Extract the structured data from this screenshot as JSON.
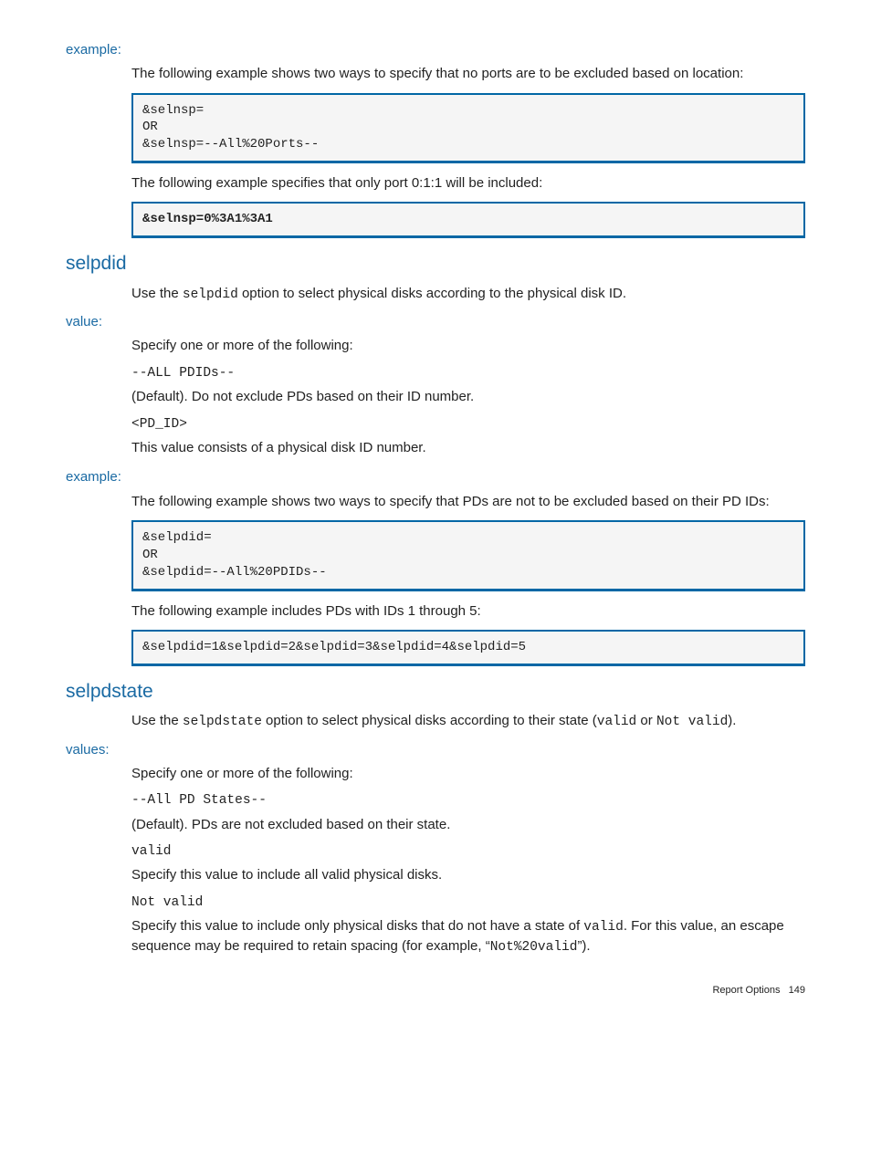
{
  "s1": {
    "heading": "example:",
    "p1": "The following example shows two ways to specify that no ports are to be excluded based on location:",
    "code1": "&selnsp=\nOR\n&selnsp=--All%20Ports--",
    "p2": "The following example specifies that only port 0:1:1 will be included:",
    "code2": "&selnsp=0%3A1%3A1"
  },
  "s2": {
    "heading": "selpdid",
    "intro_a": "Use the ",
    "intro_code": "selpdid",
    "intro_b": " option to select physical disks according to the physical disk ID.",
    "valueHeading": "value:",
    "v1": "Specify one or more of the following:",
    "v2": "--ALL PDIDs--",
    "v3": "(Default). Do not exclude PDs based on their ID number.",
    "v4": "<PD_ID>",
    "v5": "This value consists of a physical disk ID number.",
    "exampleHeading": "example:",
    "ex1": "The following example shows two ways to specify that PDs are not to be excluded based on their PD IDs:",
    "code1": "&selpdid=\nOR\n&selpdid=--All%20PDIDs--",
    "ex2": "The following example includes PDs with IDs 1 through 5:",
    "code2": "&selpdid=1&selpdid=2&selpdid=3&selpdid=4&selpdid=5"
  },
  "s3": {
    "heading": "selpdstate",
    "intro_a": "Use the ",
    "intro_code_a": "selpdstate",
    "intro_b": " option to select physical disks according to their state (",
    "intro_code_b": "valid",
    "intro_c": " or ",
    "intro_code_c": "Not valid",
    "intro_d": ").",
    "valuesHeading": "values:",
    "v1": "Specify one or more of the following:",
    "v2": "--All PD States--",
    "v3": "(Default). PDs are not excluded based on their state.",
    "v4": "valid",
    "v5": "Specify this value to include all valid physical disks.",
    "v6": "Not valid",
    "v7a": "Specify this value to include only physical disks that do not have a state of ",
    "v7code_a": "valid",
    "v7b": ". For this value, an escape sequence may be required to retain spacing (for example, “",
    "v7code_b": "Not%20valid",
    "v7c": "”)."
  },
  "footer": {
    "label": "Report Options",
    "page": "149"
  }
}
